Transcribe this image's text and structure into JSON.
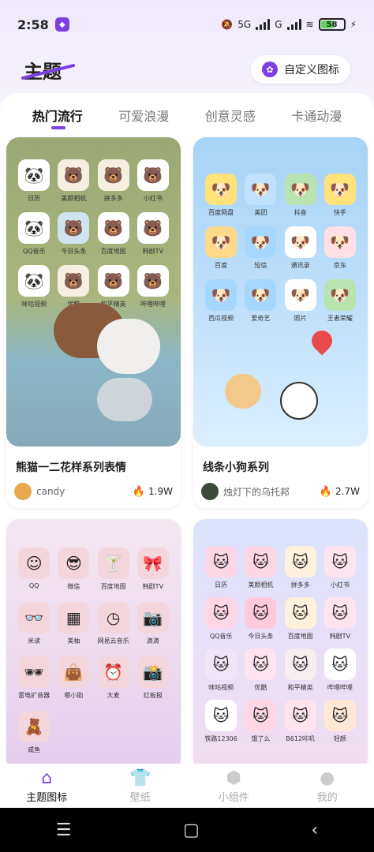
{
  "status_bar": {
    "time": "2:58",
    "network": "5G",
    "network2": "G",
    "battery": "58"
  },
  "header": {
    "title": "主题",
    "custom_button": "自定义图标"
  },
  "tabs": [
    {
      "label": "热门流行",
      "active": true
    },
    {
      "label": "可爱浪漫",
      "active": false
    },
    {
      "label": "创意灵感",
      "active": false
    },
    {
      "label": "卡通动漫",
      "active": false
    }
  ],
  "cards": [
    {
      "title": "熊猫一二花样系列表情",
      "author": "candy",
      "heat": "1.9W",
      "icons": [
        "日历",
        "美颜相机",
        "拼多多",
        "小红书",
        "QQ音乐",
        "今日头条",
        "百度地图",
        "韩剧TV",
        "咪咕视频",
        "优酷",
        "和平精英",
        "哔哩哔哩"
      ]
    },
    {
      "title": "线条小狗系列",
      "author": "烛灯下的乌托邦",
      "heat": "2.7W",
      "icons": [
        "百度网盘",
        "美团",
        "抖音",
        "快手",
        "百度",
        "短信",
        "通讯录",
        "京东",
        "西瓜视频",
        "爱奇艺",
        "照片",
        "王者荣耀"
      ]
    },
    {
      "title": "",
      "author": "",
      "heat": "",
      "icons": [
        "QQ",
        "微信",
        "百度地图",
        "韩剧TV",
        "米读",
        "美柚",
        "网易云音乐",
        "滴滴",
        "雷电扩音器",
        "哪小助",
        "大麦",
        "红板报",
        "咸鱼"
      ]
    },
    {
      "title": "",
      "author": "",
      "heat": "",
      "icons": [
        "日历",
        "美颜相机",
        "拼多多",
        "小红书",
        "QQ音乐",
        "今日头条",
        "百度地图",
        "韩剧TV",
        "咪咕视频",
        "优酷",
        "和平精英",
        "哔哩哔哩",
        "铁路12306",
        "饿了么",
        "B612咔叽",
        "轻颜"
      ]
    }
  ],
  "bottom_nav": [
    {
      "label": "主题图标",
      "icon": "house-icon",
      "active": true
    },
    {
      "label": "壁纸",
      "icon": "shirt-icon",
      "active": false
    },
    {
      "label": "小组件",
      "icon": "cube-icon",
      "active": false
    },
    {
      "label": "我的",
      "icon": "person-icon",
      "active": false
    }
  ],
  "colors": {
    "accent": "#7b3fe4",
    "heat": "#f04a3a"
  }
}
